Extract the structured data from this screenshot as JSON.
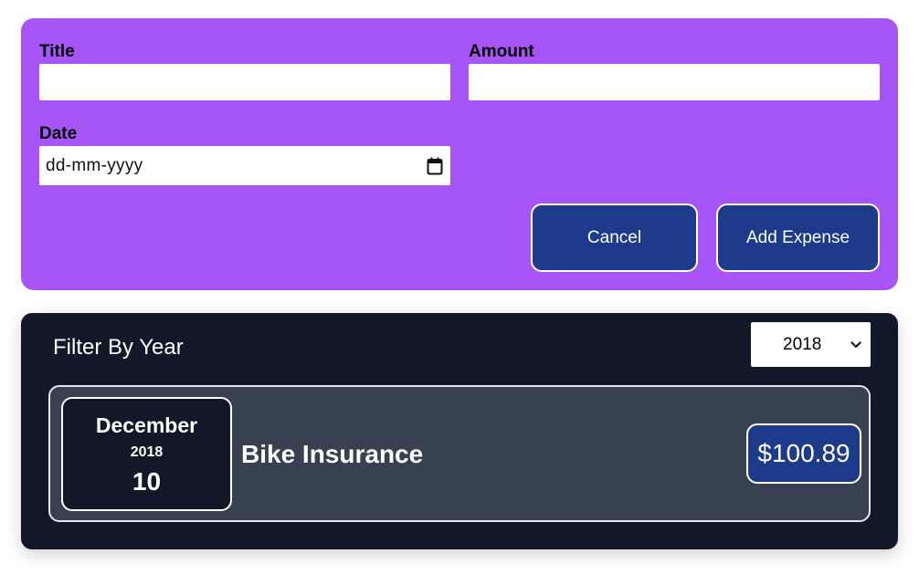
{
  "form": {
    "title_label": "Title",
    "title_value": "",
    "amount_label": "Amount",
    "amount_value": "",
    "date_label": "Date",
    "date_placeholder": "dd-mm-yyyy",
    "date_icon": "calendar-icon",
    "cancel_label": "Cancel",
    "submit_label": "Add Expense"
  },
  "filter": {
    "label": "Filter By Year",
    "selected_year": "2018",
    "dropdown_icon": "chevron-down-icon"
  },
  "expenses": [
    {
      "month": "December",
      "year": "2018",
      "day": "10",
      "title": "Bike Insurance",
      "amount": "$100.89"
    }
  ],
  "colors": {
    "form_background": "#a855f7",
    "button_background": "#1e3a8a",
    "list_background": "#111827",
    "item_background": "#374151"
  }
}
